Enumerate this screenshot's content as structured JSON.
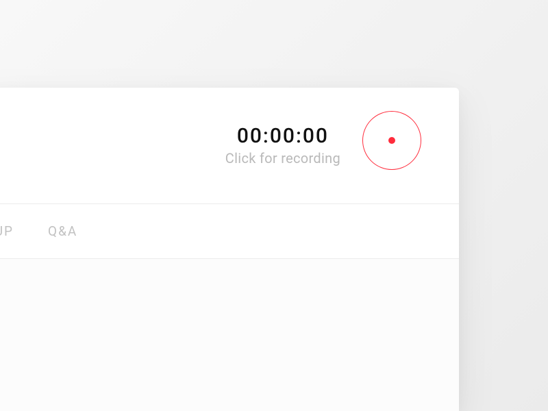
{
  "recorder": {
    "timer": "00:00:00",
    "hint": "Click for recording"
  },
  "tabs": {
    "group": "GROUP",
    "qa": "Q&A"
  },
  "colors": {
    "accent": "#ff2c3c"
  }
}
